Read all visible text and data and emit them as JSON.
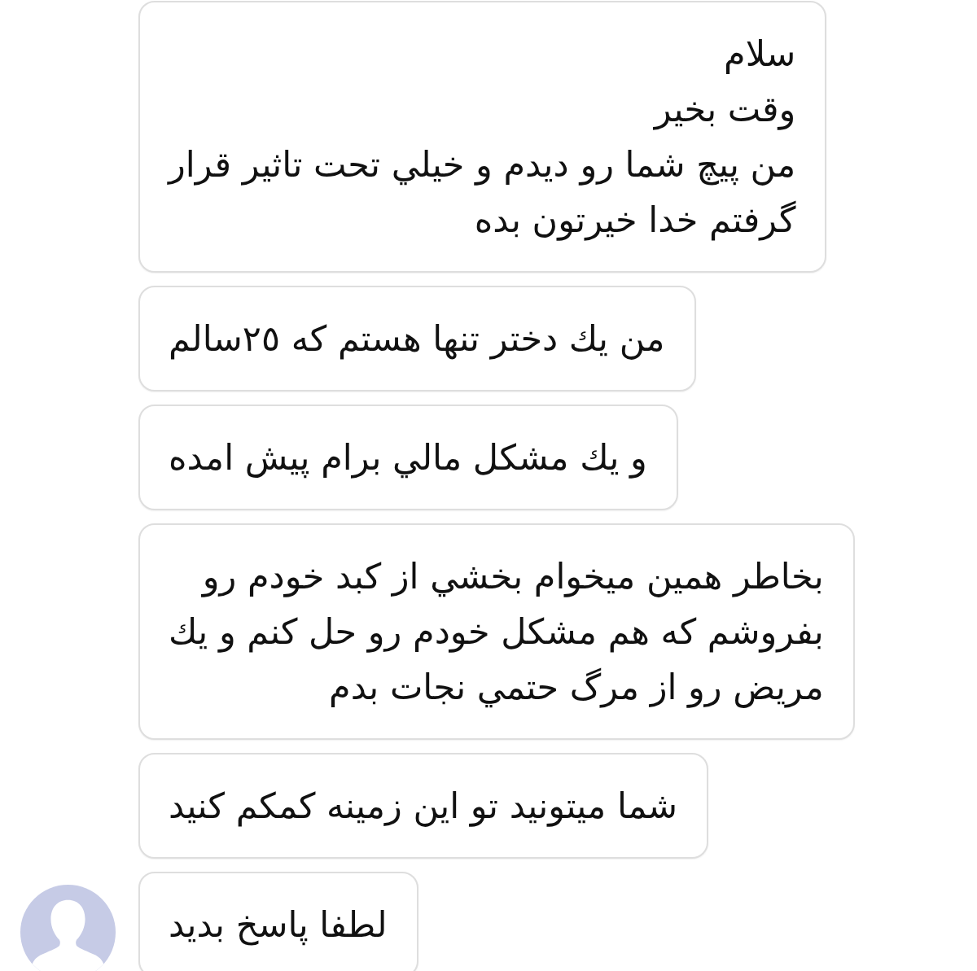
{
  "messages": [
    {
      "lines": [
        "سلام",
        "وقت بخير",
        "من پيچ شما رو ديدم و خيلي تحت تاثير قرار",
        "گرفتم خدا خيرتون بده"
      ],
      "avatar": false
    },
    {
      "lines": [
        "من يك دختر تنها هستم كه ٢٥سالم"
      ],
      "avatar": false
    },
    {
      "lines": [
        "و يك مشكل مالي برام پيش امده"
      ],
      "avatar": false
    },
    {
      "lines": [
        "بخاطر همين ميخوام بخشي از كبد خودم رو",
        "بفروشم كه هم مشكل خودم رو حل كنم و يك",
        "مريض رو از مرگ حتمي نجات بدم"
      ],
      "avatar": false
    },
    {
      "lines": [
        "شما ميتونيد تو اين زمينه كمكم كنيد"
      ],
      "avatar": false
    },
    {
      "lines": [
        "لطفا پاسخ بديد"
      ],
      "avatar": true
    }
  ]
}
